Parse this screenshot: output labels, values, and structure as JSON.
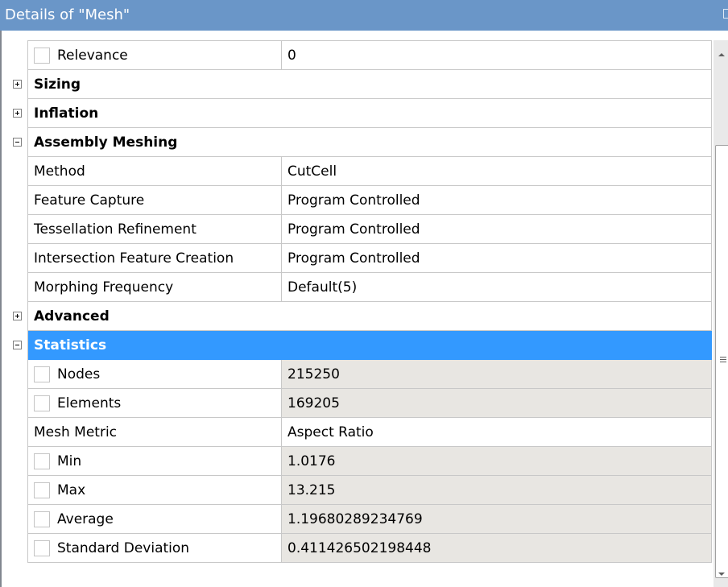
{
  "panel": {
    "title": "Details of \"Mesh\""
  },
  "rows": {
    "relevance": {
      "label": "Relevance",
      "value": "0"
    },
    "sizing": {
      "label": "Sizing"
    },
    "inflation": {
      "label": "Inflation"
    },
    "assembly_meshing": {
      "label": "Assembly Meshing"
    },
    "method": {
      "label": "Method",
      "value": "CutCell"
    },
    "feature_capture": {
      "label": "Feature Capture",
      "value": "Program Controlled"
    },
    "tessellation_refinement": {
      "label": "Tessellation Refinement",
      "value": "Program Controlled"
    },
    "intersection_feature_creation": {
      "label": "Intersection Feature Creation",
      "value": "Program Controlled"
    },
    "morphing_frequency": {
      "label": "Morphing Frequency",
      "value": "Default(5)"
    },
    "advanced": {
      "label": "Advanced"
    },
    "statistics": {
      "label": "Statistics"
    },
    "nodes": {
      "label": "Nodes",
      "value": "215250"
    },
    "elements": {
      "label": "Elements",
      "value": "169205"
    },
    "mesh_metric": {
      "label": "Mesh Metric",
      "value": "Aspect Ratio"
    },
    "min": {
      "label": "Min",
      "value": "1.0176"
    },
    "max": {
      "label": "Max",
      "value": "13.215"
    },
    "average": {
      "label": "Average",
      "value": "1.19680289234769"
    },
    "standard_deviation": {
      "label": "Standard Deviation",
      "value": "0.411426502198448"
    }
  },
  "icons": {
    "expand": "plus-icon",
    "collapse": "minus-icon"
  },
  "colors": {
    "title_bar": "#6a96c8",
    "selection": "#3399ff",
    "readonly_cell": "#e8e6e2",
    "grid_line": "#c8c8c8"
  }
}
